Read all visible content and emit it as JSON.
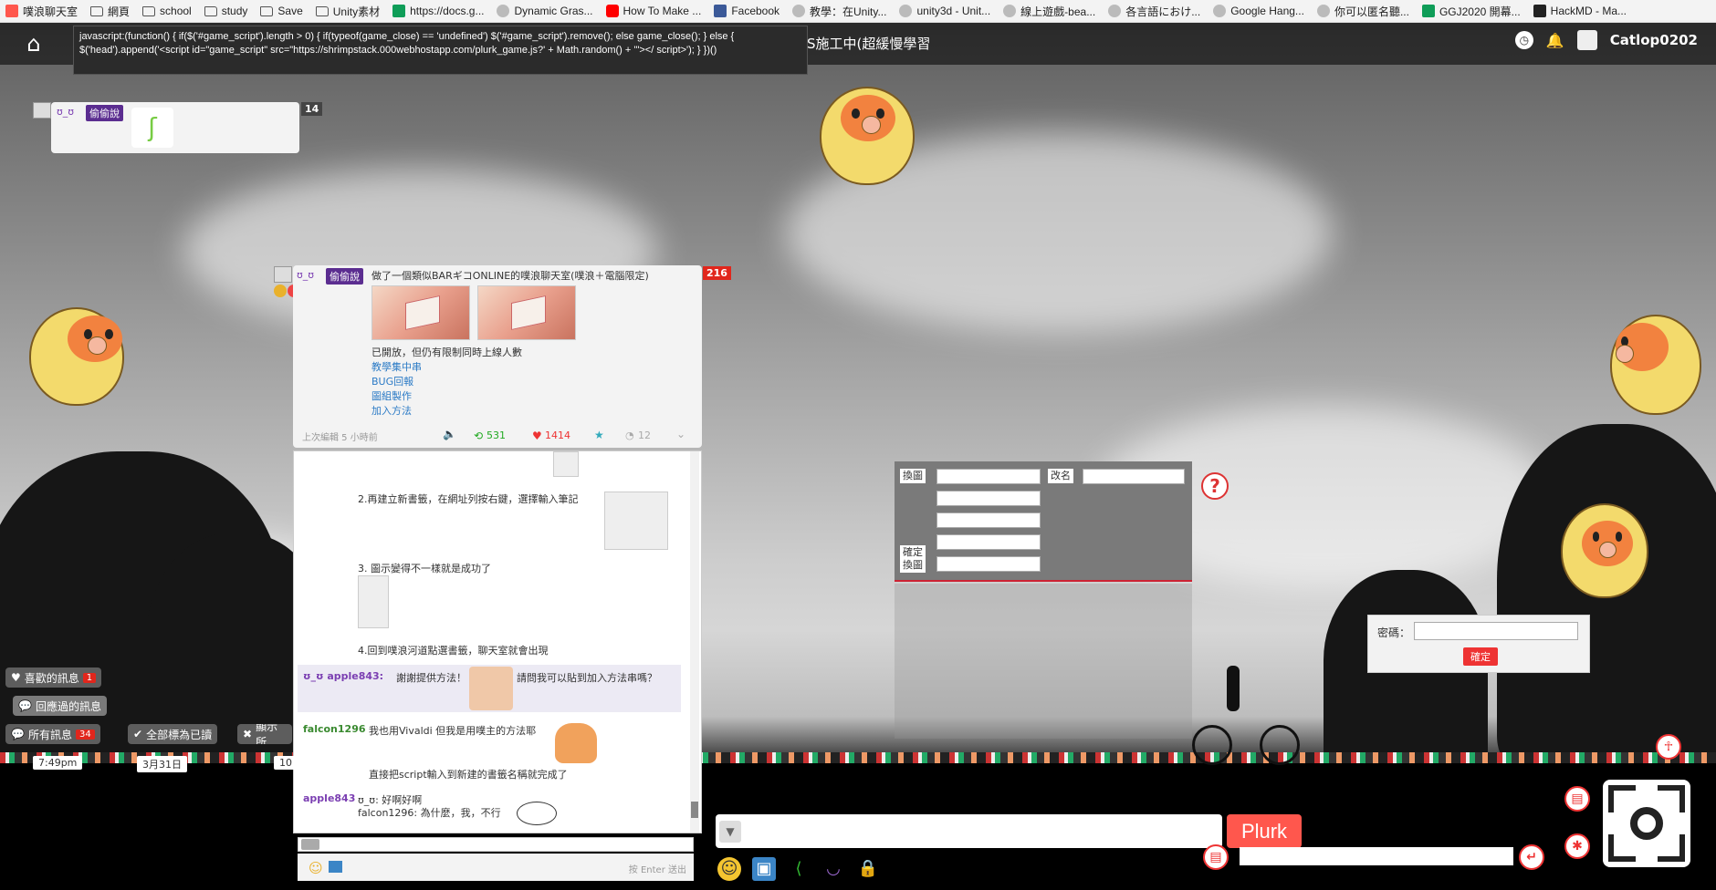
{
  "bookmarks": [
    {
      "label": "噗浪聊天室",
      "icon": "plurk-icon"
    },
    {
      "label": "網頁",
      "icon": "folder-icon"
    },
    {
      "label": "school",
      "icon": "folder-icon"
    },
    {
      "label": "study",
      "icon": "folder-icon"
    },
    {
      "label": "Save",
      "icon": "folder-icon"
    },
    {
      "label": "Unity素材",
      "icon": "folder-icon"
    },
    {
      "label": "https://docs.g...",
      "icon": "sheets-icon"
    },
    {
      "label": "Dynamic Gras...",
      "icon": "globe-icon"
    },
    {
      "label": "How To Make ...",
      "icon": "youtube-icon"
    },
    {
      "label": "Facebook",
      "icon": "facebook-icon"
    },
    {
      "label": "教學：在Unity...",
      "icon": "globe-icon"
    },
    {
      "label": "unity3d - Unit...",
      "icon": "globe-icon"
    },
    {
      "label": "線上遊戲-bea...",
      "icon": "globe-icon"
    },
    {
      "label": "各言語におけ...",
      "icon": "globe-icon"
    },
    {
      "label": "Google Hang...",
      "icon": "globe-icon"
    },
    {
      "label": "你可以匿名聽...",
      "icon": "globe-icon"
    },
    {
      "label": "GGJ2020 開幕...",
      "icon": "sheets-icon"
    },
    {
      "label": "HackMD - Ma...",
      "icon": "hackmd-icon"
    }
  ],
  "tooltip": "javascript:(function() { if($('#game_script').length > 0) { if(typeof(game_close) == 'undefined') $('#game_script').remove(); else game_close(); } else { $('head').append('<script id=\"game_script\" src=\"https://shrimpstack.000webhostapp.com/plurk_game.js?' + Math.random() + '\"></ script>'); } })()",
  "nav": {
    "title_fragment": "S施工中(超緩慢學習",
    "user": "Catlop0202"
  },
  "small_card": {
    "nick": "ʊ_ʊ",
    "badge": "偷偷說",
    "count": "14"
  },
  "main_card": {
    "nick": "ʊ_ʊ",
    "badge": "偷偷說",
    "count": "216",
    "headline": "做了一個類似BARギコONLINE的噗浪聊天室(噗浪＋電腦限定)",
    "body": "已開放，但仍有限制同時上線人數",
    "links": [
      "教學集中串",
      "BUG回報",
      "圖組製作",
      "加入方法"
    ],
    "edited": "上次編輯 5 小時前",
    "replurks": "531",
    "likes": "1414",
    "responses": "12"
  },
  "responses": {
    "step2": "2.再建立新書籤，在網址列按右鍵，選擇輸入筆記",
    "step3": "3. 圖示變得不一樣就是成功了",
    "step4": "4.回到噗浪河道點選書籤，聊天室就會出現",
    "r1_name": "ʊ_ʊ apple843:",
    "r1_text": "謝謝提供方法！",
    "r1_text2": "請問我可以貼到加入方法串嗎？",
    "r2_name": "falcon1296",
    "r2_text": "我也用Vivaldi 但我是用噗主的方法耶",
    "r2_text2": "直接把script輸入到新建的書籤名稱就完成了",
    "r3_name": "apple843",
    "r3_text": "ʊ_ʊ: 好啊好啊",
    "r3_text2": "falcon1296: 為什麼，我，不行",
    "enter_hint": "按 Enter 送出"
  },
  "filters": {
    "liked": "喜歡的訊息",
    "liked_count": "1",
    "replied": "回應過的訊息",
    "all": "所有訊息",
    "all_count": "34",
    "mark_read": "全部標為已讀",
    "show": "顯示所"
  },
  "timeline": {
    "time": "7:49pm",
    "date": "3月31日",
    "partial": "10"
  },
  "form": {
    "swap_label": "換圖",
    "rename_label": "改名",
    "confirm_swap_label": "確定\n換圖",
    "help": "?"
  },
  "password": {
    "label": "密碼：",
    "button": "確定"
  },
  "compose": {
    "plurk_button": "Plurk"
  },
  "colors": {
    "accent": "#ff574d",
    "badge": "#5b2d90",
    "count_red": "#e1261c"
  }
}
